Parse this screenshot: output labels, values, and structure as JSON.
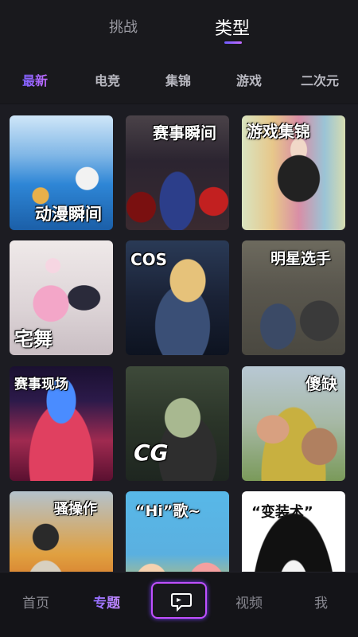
{
  "top_tabs": [
    {
      "label": "挑战"
    },
    {
      "label": "类型"
    }
  ],
  "categories": [
    {
      "label": "最新"
    },
    {
      "label": "电竞"
    },
    {
      "label": "集锦"
    },
    {
      "label": "游戏"
    },
    {
      "label": "二次元"
    }
  ],
  "cards": [
    {
      "title": "动漫瞬间"
    },
    {
      "title": "赛事瞬间"
    },
    {
      "title": "游戏集锦"
    },
    {
      "title": "宅舞"
    },
    {
      "title": "COS"
    },
    {
      "title": "明星选手"
    },
    {
      "title": "赛事现场"
    },
    {
      "title": "CG"
    },
    {
      "title": "傻缺"
    },
    {
      "title": "骚操作"
    },
    {
      "title": "“Hi”歌~"
    },
    {
      "title": "“变装术”"
    }
  ],
  "bottom_nav": [
    {
      "label": "首页"
    },
    {
      "label": "专题"
    },
    {
      "label": "视频"
    },
    {
      "label": "我"
    }
  ],
  "icons": {
    "center": "video-chat-icon"
  },
  "colors": {
    "accent_start": "#7b61ff",
    "accent_end": "#c36bff",
    "background": "#1c1c22"
  }
}
